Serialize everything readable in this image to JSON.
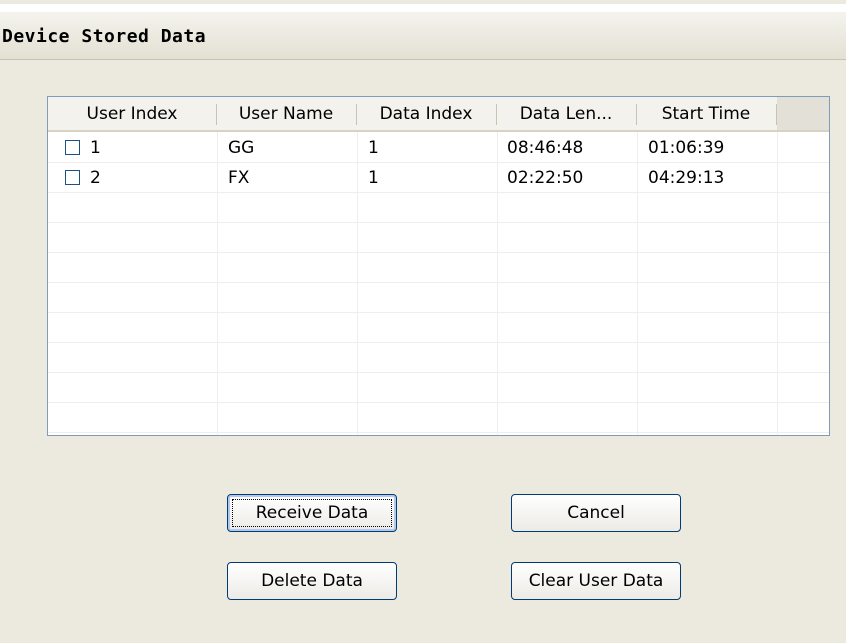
{
  "window": {
    "title": "Device Stored Data"
  },
  "table": {
    "columns": [
      "User Index",
      "User Name",
      "Data Index",
      "Data Len...",
      "Start Time"
    ],
    "rows": [
      {
        "user_index": "1",
        "user_name": "GG",
        "data_index": "1",
        "data_len": "08:46:48",
        "start_time": "01:06:39",
        "checked": false
      },
      {
        "user_index": "2",
        "user_name": "FX",
        "data_index": "1",
        "data_len": "02:22:50",
        "start_time": "04:29:13",
        "checked": false
      }
    ]
  },
  "buttons": {
    "receive": "Receive Data",
    "cancel": "Cancel",
    "delete": "Delete Data",
    "clear": "Clear User Data"
  }
}
